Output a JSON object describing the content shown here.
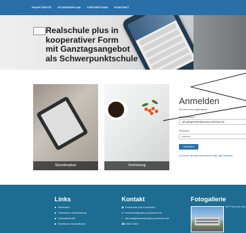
{
  "nav": {
    "items": [
      "HAUPTSEITE",
      "STUNDENPLAN",
      "VERTRETUNG",
      "KONTAKT"
    ]
  },
  "hero": {
    "lines": [
      "Realschule plus in",
      "kooperativer Form",
      "mit Ganztagsangebot",
      "als Schwerpunktschule"
    ]
  },
  "cards": [
    {
      "label": "Stundenplan"
    },
    {
      "label": "Vertretung"
    }
  ],
  "login": {
    "title": "Anmelden",
    "subtitle": "Sie sind nicht angemeldet!",
    "username_label": "Benutzername:",
    "username_value": "ralf.waldgenbach@rsplus-puderbach.de",
    "password_label": "Passwort:",
    "password_value": "••••••••••",
    "button_label": "Anmelden",
    "forgot_link": "Ich kenne den Benutzernamen oder das Passwort"
  },
  "footer": {
    "links": {
      "title": "Links",
      "items": [
        "Webmailer",
        "Technische Unterstützung",
        "Unterstützerbild",
        "Rechtliche Informationen"
      ]
    },
    "contact": {
      "title": "Kontakt",
      "items": [
        "Realschule plus Puderbach",
        "sekretariat@rsplus-puderbach.de",
        "ralf.waldgenbach@rsplus-puderbach.de",
        "02684 9593"
      ]
    },
    "gallery": {
      "title": "Fotogallerie",
      "text": "Die Fotos von uns"
    }
  },
  "colors": {
    "nav": "#2b6fa8",
    "footer": "#1d6c91",
    "accent": "#2b6fa8"
  }
}
